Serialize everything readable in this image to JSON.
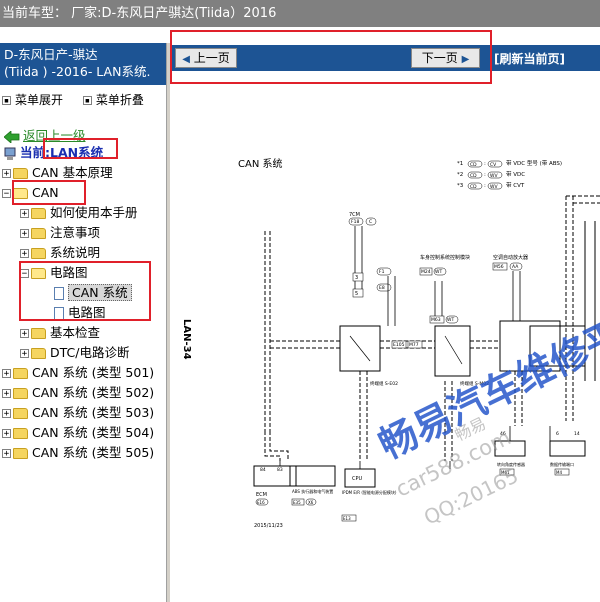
{
  "top_bar": {
    "text": "当前车型： 厂家:D-东风日产骐达(Tiida）2016"
  },
  "sidebar": {
    "title_line1": "D-东风日产-骐达",
    "title_line2": "(Tiida ) -2016- LAN系统.",
    "expand_all": "菜单展开",
    "collapse_all": "菜单折叠",
    "back": "返回上一级",
    "current_label": "当前:",
    "current_value": "LAN系统",
    "tree": [
      {
        "label": "CAN 基本原理",
        "expander": "+"
      },
      {
        "label": "CAN",
        "expander": "−"
      },
      {
        "label": "如何使用本手册",
        "expander": "+"
      },
      {
        "label": "注意事项",
        "expander": "+"
      },
      {
        "label": "系统说明",
        "expander": "+"
      },
      {
        "label": "电路图",
        "expander": "−"
      },
      {
        "label": "CAN 系统"
      },
      {
        "label": "电路图"
      },
      {
        "label": "基本检查",
        "expander": "+"
      },
      {
        "label": "DTC/电路诊断",
        "expander": "+"
      },
      {
        "label": "CAN 系统 (类型 501)",
        "expander": "+"
      },
      {
        "label": "CAN 系统 (类型 502)",
        "expander": "+"
      },
      {
        "label": "CAN 系统 (类型 503)",
        "expander": "+"
      },
      {
        "label": "CAN 系统 (类型 504)",
        "expander": "+"
      },
      {
        "label": "CAN 系统 (类型 505)",
        "expander": "+"
      }
    ]
  },
  "nav": {
    "prev": "上一页",
    "next": "下一页",
    "refresh": "[刷新当前页]"
  },
  "diagram": {
    "title": "CAN 系统",
    "page_label": "LAN-34",
    "date": "2015/11/23",
    "legend": [
      {
        "num": "*1",
        "tag": "CD",
        "tag2": "CV",
        "text": "带 VDC 型号 (带 ABS)"
      },
      {
        "num": "*2",
        "tag": "CD",
        "tag2": "WV",
        "text": "带 VDC"
      },
      {
        "num": "*3",
        "tag": "CD",
        "tag2": "WV",
        "text": "带 CVT"
      }
    ],
    "labels": {
      "fuse_7cm": "7CM",
      "f18": "F18",
      "c": "C",
      "f1": "F1",
      "e8": "E8",
      "m24": "M24",
      "m63": "M63",
      "m56": "M56",
      "aa": "AA",
      "wt": "WT",
      "dash": "—",
      "e105": "E105",
      "m77": "M77",
      "e120": "E120",
      "m78": "M78",
      "conn_m02": "终端组 S-M02",
      "conn_e02": "终端组 S-E02",
      "can_sys_label": "车身控制系统控制模块",
      "ac_label": "空调自动放大器",
      "steering_label": "转向角度传感器",
      "display_label": "数据传输端口",
      "n3": "3",
      "n5": "5",
      "n6": "6",
      "n7": "7",
      "n10": "10",
      "n12": "12",
      "n14": "14",
      "n46": "46",
      "n55": "55",
      "n83": "83",
      "n84": "84",
      "n41": "41",
      "n42": "42",
      "cpu": "CPU",
      "ecm": "ECM",
      "e16": "E16",
      "e35": "E35",
      "abs_label": "ABS 执行器和电气装置",
      "ipdm_label": "IPDM E/R (智能电源分配模块)",
      "m61": "M61",
      "m4": "M4",
      "e13": "E13",
      "x6": "X6",
      "wv": "WV"
    }
  },
  "watermarks": {
    "main": "畅易汽车维修平台",
    "site": "car588.com",
    "qq": "QQ:20165",
    "mid": "畅易"
  },
  "colors": {
    "accent": "#1d5494",
    "highlight": "#e0202a",
    "top_bar": "#808080",
    "folder": "#f5d560",
    "watermark": "#1e50c8"
  }
}
